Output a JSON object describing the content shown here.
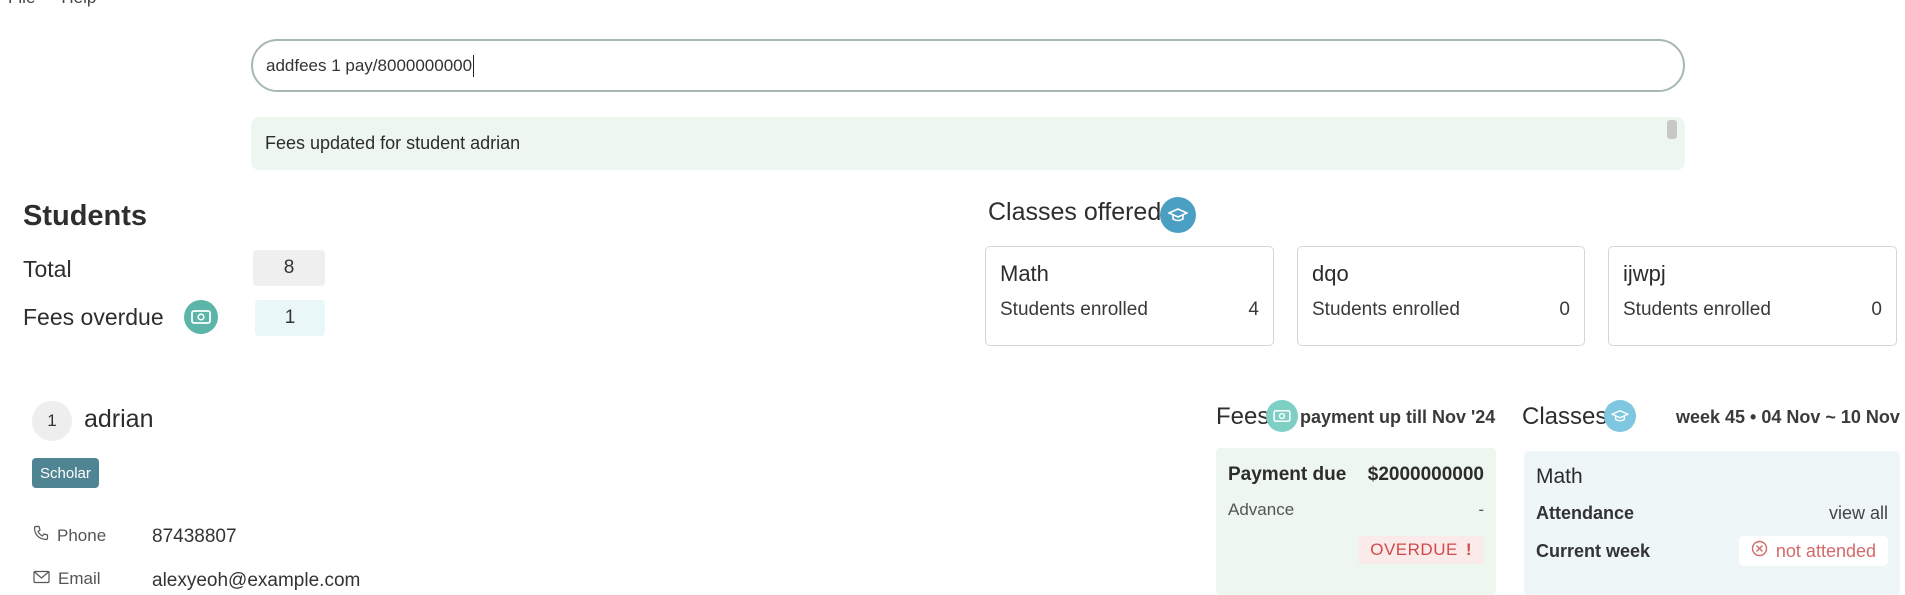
{
  "menu": {
    "items": [
      "File",
      "Help"
    ]
  },
  "command": {
    "value": "addfees 1 pay/8000000000"
  },
  "result": {
    "message": "Fees updated for student adrian"
  },
  "students": {
    "title": "Students",
    "total_label": "Total",
    "total_value": "8",
    "overdue_label": "Fees overdue",
    "overdue_value": "1"
  },
  "classes_offered": {
    "title": "Classes offered",
    "cards": [
      {
        "name": "Math",
        "enrolled_label": "Students enrolled",
        "enrolled_value": "4"
      },
      {
        "name": "dqo",
        "enrolled_label": "Students enrolled",
        "enrolled_value": "0"
      },
      {
        "name": "ijwpj",
        "enrolled_label": "Students enrolled",
        "enrolled_value": "0"
      }
    ]
  },
  "student": {
    "index": "1",
    "name": "adrian",
    "tag": "Scholar",
    "phone_label": "Phone",
    "phone_value": "87438807",
    "email_label": "Email",
    "email_value": "alexyeoh@example.com"
  },
  "fees": {
    "title": "Fees",
    "subtitle": "payment up till Nov '24",
    "payment_due_label": "Payment due",
    "payment_due_value": "$2000000000",
    "advance_label": "Advance",
    "advance_value": "-",
    "status": "OVERDUE",
    "status_mark": "!"
  },
  "classes": {
    "title": "Classes",
    "week": "week 45 • 04 Nov ~ 10 Nov",
    "class_name": "Math",
    "attendance_label": "Attendance",
    "view_all": "view all",
    "current_week_label": "Current week",
    "current_week_status": "not attended"
  },
  "colors": {
    "accent_teal": "#5bb5a8",
    "accent_blue": "#4a9fc2",
    "overdue_red": "#d14a4a",
    "tag_bg": "#4f8593"
  },
  "icons": [
    "money-icon",
    "graduation-cap-icon",
    "phone-icon",
    "email-icon",
    "cancel-circle-icon"
  ]
}
